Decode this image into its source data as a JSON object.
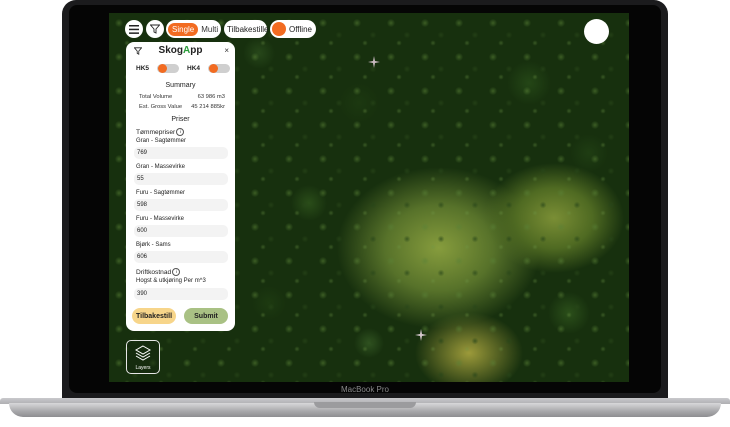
{
  "device": {
    "brand_label": "MacBook Pro"
  },
  "toolbar": {
    "mode_single": "Single",
    "mode_multi": "Multi",
    "reset_label": "Tilbakestille",
    "offline_label": "Offline",
    "accent_color": "#f26b21"
  },
  "panel": {
    "title_left": "Skog",
    "title_accent": "A",
    "title_right": "pp",
    "close_glyph": "×",
    "toggles": [
      {
        "label": "HK5",
        "on": true
      },
      {
        "label": "HK4",
        "on": true
      }
    ],
    "summary": {
      "title": "Summary",
      "rows": [
        {
          "label": "Total Volume",
          "value": "63 986 m3"
        },
        {
          "label": "Est. Gross Value",
          "value": "45 214 885kr"
        }
      ]
    },
    "prices": {
      "title": "Priser",
      "timber_heading": "Tømmepriser",
      "items": [
        {
          "label": "Gran - Sagtømmer",
          "value": "769"
        },
        {
          "label": "Gran - Massevirke",
          "value": "55"
        },
        {
          "label": "Furu - Sagtømmer",
          "value": "598"
        },
        {
          "label": "Furu - Massevirke",
          "value": "600"
        },
        {
          "label": "Bjørk - Sams",
          "value": "606"
        }
      ],
      "operating_heading": "Driftkostnad",
      "operating_items": [
        {
          "label": "Hogst & utkjøring Per m^3",
          "value": "390"
        }
      ]
    },
    "reset_button": "Tilbakestill",
    "submit_button": "Submit",
    "reset_color": "#f7d58a",
    "submit_color": "#a9c184"
  },
  "layers": {
    "label": "Layers"
  }
}
